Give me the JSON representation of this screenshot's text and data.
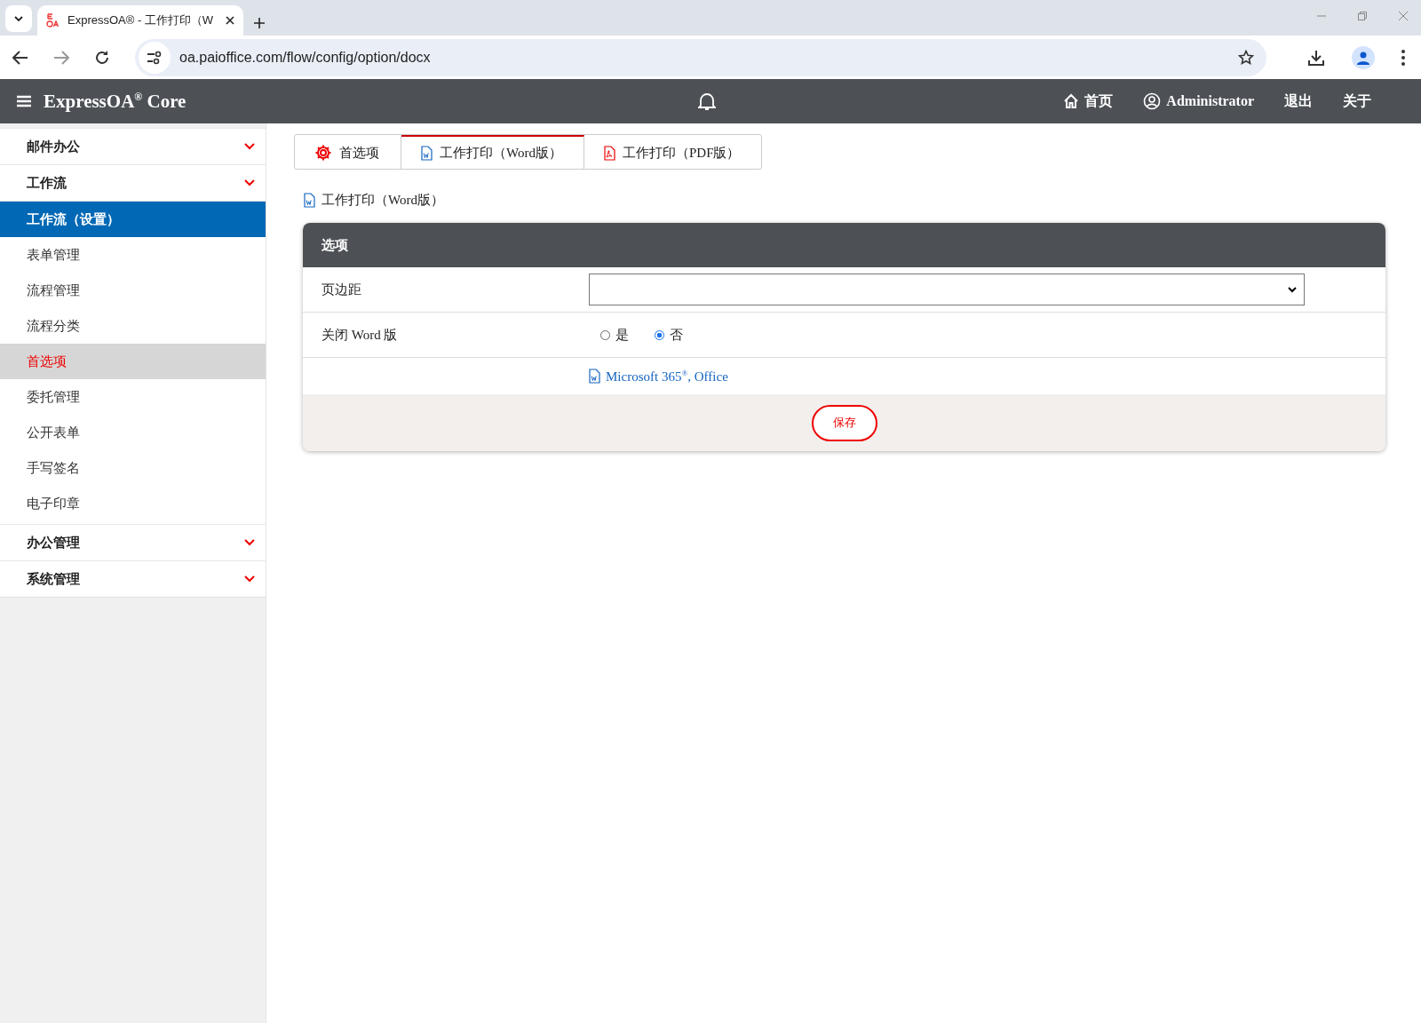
{
  "browser": {
    "tab_title": "ExpressOA® - 工作打印（W",
    "url": "oa.paioffice.com/flow/config/option/docx"
  },
  "header": {
    "brand": "ExpressOA$^{®}$ Core",
    "nav": [
      {
        "kind": "home",
        "label": "首页"
      },
      {
        "kind": "user",
        "label": "Administrator"
      },
      {
        "kind": "plain",
        "label": "退出"
      },
      {
        "kind": "plain",
        "label": "关于"
      }
    ]
  },
  "sidebar": {
    "items": [
      {
        "label": "邮件办公"
      },
      {
        "label": "工作流",
        "expanded": true,
        "children": [
          {
            "kind": "heading",
            "label": "工作流（设置）"
          },
          {
            "kind": "link",
            "label": "表单管理",
            "selected": false
          },
          {
            "kind": "link",
            "label": "流程管理",
            "selected": false
          },
          {
            "kind": "link",
            "label": "流程分类",
            "selected": false
          },
          {
            "kind": "link",
            "label": "首选项",
            "selected": true
          },
          {
            "kind": "link",
            "label": "委托管理",
            "selected": false
          },
          {
            "kind": "link",
            "label": "公开表单",
            "selected": false
          },
          {
            "kind": "link",
            "label": "手写签名",
            "selected": false
          },
          {
            "kind": "link",
            "label": "电子印章",
            "selected": false
          }
        ]
      },
      {
        "label": "办公管理"
      },
      {
        "label": "系统管理"
      }
    ]
  },
  "tabs": [
    {
      "kind": "gear",
      "label": "首选项",
      "selected": false
    },
    {
      "kind": "word",
      "label": "工作打印（Word版）",
      "selected": true
    },
    {
      "kind": "pdf",
      "label": "工作打印（PDF版）",
      "selected": false
    }
  ],
  "page_title": "工作打印（Word版）",
  "panel": {
    "title": "选项",
    "rows": [
      {
        "kind": "select",
        "label": "页边距"
      },
      {
        "kind": "radio",
        "label": "关闭 Word 版",
        "options": [
          {
            "label": "是",
            "selected": false
          },
          {
            "label": "否",
            "selected": true
          }
        ]
      },
      {
        "kind": "link",
        "text": "Microsoft 365$^{®}$, Office"
      }
    ],
    "save": "保存"
  }
}
